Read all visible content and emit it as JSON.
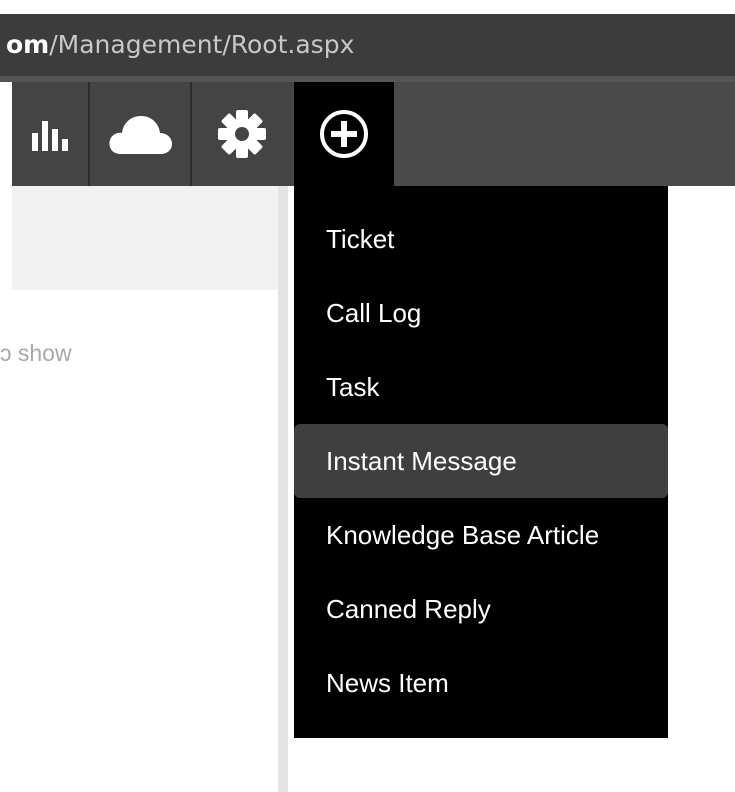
{
  "browser": {
    "url_host_fragment": "om",
    "url_path": "/Management/Root.aspx"
  },
  "toolbar": {
    "buttons": [
      {
        "icon": "bar-chart-icon"
      },
      {
        "icon": "cloud-icon"
      },
      {
        "icon": "gear-icon"
      },
      {
        "icon": "plus-circle-icon",
        "active": true
      }
    ]
  },
  "main": {
    "empty_text": "ɔ show"
  },
  "new_menu": {
    "items": [
      {
        "label": "Ticket"
      },
      {
        "label": "Call Log"
      },
      {
        "label": "Task"
      },
      {
        "label": "Instant Message",
        "hovered": true
      },
      {
        "label": "Knowledge Base Article"
      },
      {
        "label": "Canned Reply"
      },
      {
        "label": "News Item"
      }
    ]
  },
  "colors": {
    "toolbar_bg": "#4a4a4a",
    "menu_bg": "#000000",
    "menu_hover": "#3f3f3f",
    "menu_text": "#ffffff"
  }
}
